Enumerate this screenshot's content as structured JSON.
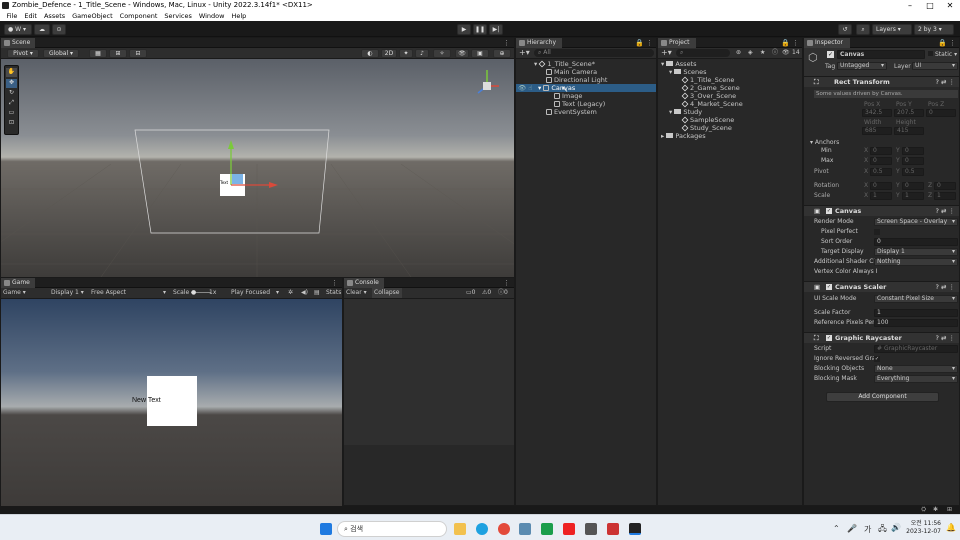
{
  "window": {
    "title": "Zombie_Defence - 1_Title_Scene - Windows, Mac, Linux - Unity 2022.3.14f1* <DX11>"
  },
  "menu": [
    "File",
    "Edit",
    "Assets",
    "GameObject",
    "Component",
    "Services",
    "Window",
    "Help"
  ],
  "toolbar": {
    "account": "W",
    "layers": "Layers",
    "layout": "2 by 3"
  },
  "scene": {
    "tab": "Scene",
    "pivot": "Pivot",
    "global": "Global",
    "mode2d": "2D",
    "text_label": "Text"
  },
  "game": {
    "tab": "Game",
    "mode": "Game",
    "display": "Display 1",
    "aspect": "Free Aspect",
    "scale_label": "Scale",
    "scale_value": "1x",
    "play_focused": "Play Focused",
    "stats": "Stats",
    "new_text": "New Text"
  },
  "console": {
    "tab": "Console",
    "clear": "Clear",
    "collapse": "Collapse",
    "c1": "0",
    "c2": "0",
    "c3": "0"
  },
  "hierarchy": {
    "tab": "Hierarchy",
    "search": "All",
    "scene": "1_Title_Scene*",
    "items": [
      {
        "label": "Main Camera",
        "indent": 1
      },
      {
        "label": "Directional Light",
        "indent": 1
      },
      {
        "label": "Canvas",
        "indent": 1
      },
      {
        "label": "Image",
        "indent": 2
      },
      {
        "label": "Text (Legacy)",
        "indent": 2
      },
      {
        "label": "EventSystem",
        "indent": 1
      }
    ]
  },
  "project": {
    "tab": "Project",
    "count": "14",
    "items": [
      {
        "label": "Assets",
        "type": "folder",
        "indent": 0
      },
      {
        "label": "Scenes",
        "type": "folder",
        "indent": 1
      },
      {
        "label": "1_Title_Scene",
        "type": "scene",
        "indent": 2
      },
      {
        "label": "2_Game_Scene",
        "type": "scene",
        "indent": 2
      },
      {
        "label": "3_Over_Scene",
        "type": "scene",
        "indent": 2
      },
      {
        "label": "4_Market_Scene",
        "type": "scene",
        "indent": 2
      },
      {
        "label": "Study",
        "type": "folder",
        "indent": 1
      },
      {
        "label": "SampleScene",
        "type": "scene",
        "indent": 2
      },
      {
        "label": "Study_Scene",
        "type": "scene",
        "indent": 2
      },
      {
        "label": "Packages",
        "type": "folder",
        "indent": 0
      }
    ]
  },
  "inspector": {
    "tab": "Inspector",
    "object_name": "Canvas",
    "static": "Static",
    "tag_label": "Tag",
    "tag": "Untagged",
    "layer_label": "Layer",
    "layer": "UI",
    "rect": {
      "title": "Rect Transform",
      "note": "Some values driven by Canvas.",
      "h_posx": "Pos X",
      "h_posy": "Pos Y",
      "h_posz": "Pos Z",
      "posx": "342.5",
      "posy": "207.5",
      "posz": "0",
      "h_width": "Width",
      "h_height": "Height",
      "width": "685",
      "height": "415",
      "anchors": "Anchors",
      "min": "Min",
      "max": "Max",
      "pivot": "Pivot",
      "rotation": "Rotation",
      "scale": "Scale",
      "x": "X",
      "y": "Y",
      "z": "Z",
      "min_x": "0",
      "min_y": "0",
      "max_x": "0",
      "max_y": "0",
      "pivot_x": "0.5",
      "pivot_y": "0.5",
      "rot_x": "0",
      "rot_y": "0",
      "rot_z": "0",
      "scale_x": "1",
      "scale_y": "1",
      "scale_z": "1"
    },
    "canvas": {
      "title": "Canvas",
      "render_mode_label": "Render Mode",
      "render_mode": "Screen Space - Overlay",
      "pixel_perfect": "Pixel Perfect",
      "sort_order_label": "Sort Order",
      "sort_order": "0",
      "target_display_label": "Target Display",
      "target_display": "Display 1",
      "shader_ch_label": "Additional Shader Ch",
      "shader_ch": "Nothing",
      "vertex_color": "Vertex Color Always I"
    },
    "scaler": {
      "title": "Canvas Scaler",
      "ui_scale_label": "UI Scale Mode",
      "ui_scale": "Constant Pixel Size",
      "scale_factor_label": "Scale Factor",
      "scale_factor": "1",
      "ref_ppu_label": "Reference Pixels Per",
      "ref_ppu": "100"
    },
    "raycaster": {
      "title": "Graphic Raycaster",
      "script_label": "Script",
      "script": "GraphicRaycaster",
      "ignore_label": "Ignore Reversed Gra",
      "blocking_objects_label": "Blocking Objects",
      "blocking_objects": "None",
      "blocking_mask_label": "Blocking Mask",
      "blocking_mask": "Everything"
    },
    "add_component": "Add Component"
  },
  "taskbar": {
    "search": "검색",
    "lang": "가",
    "time": "오전 11:56",
    "date": "2023-12-07"
  }
}
